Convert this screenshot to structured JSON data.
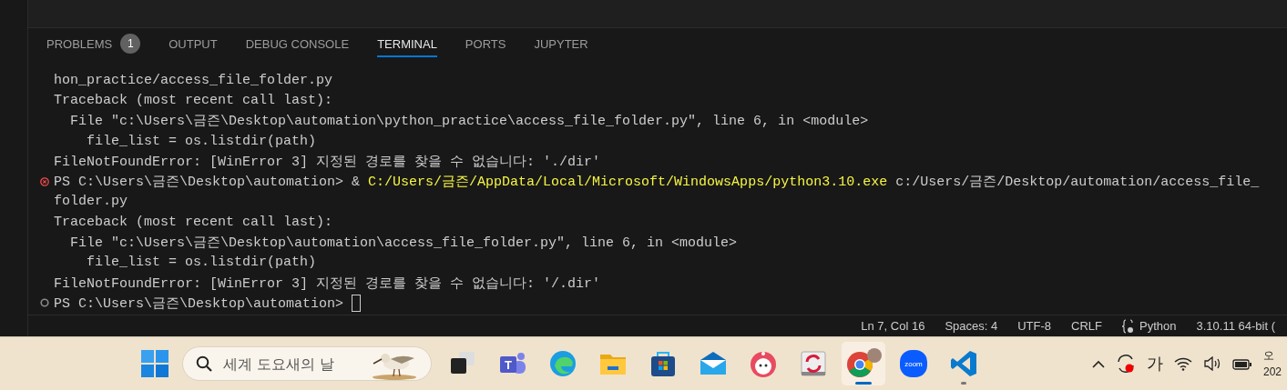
{
  "panel": {
    "tabs": [
      {
        "label": "PROBLEMS",
        "badge": "1",
        "selected": false
      },
      {
        "label": "OUTPUT",
        "selected": false
      },
      {
        "label": "DEBUG CONSOLE",
        "selected": false
      },
      {
        "label": "TERMINAL",
        "selected": true
      },
      {
        "label": "PORTS",
        "selected": false
      },
      {
        "label": "JUPYTER",
        "selected": false
      }
    ]
  },
  "terminal": {
    "lines": [
      {
        "prompt": false,
        "failed": false,
        "cursor": false,
        "segments": [
          {
            "kind": "plain",
            "text": "hon_practice/access_file_folder.py"
          }
        ]
      },
      {
        "prompt": false,
        "failed": false,
        "cursor": false,
        "segments": [
          {
            "kind": "plain",
            "text": "Traceback (most recent call last):"
          }
        ]
      },
      {
        "prompt": false,
        "failed": false,
        "cursor": false,
        "segments": [
          {
            "kind": "plain",
            "text": "  File \"c:\\Users\\금즌\\Desktop\\automation\\python_practice\\access_file_folder.py\", line 6, in <module>"
          }
        ]
      },
      {
        "prompt": false,
        "failed": false,
        "cursor": false,
        "segments": [
          {
            "kind": "plain",
            "text": "    file_list = os.listdir(path)"
          }
        ]
      },
      {
        "prompt": false,
        "failed": false,
        "cursor": false,
        "segments": [
          {
            "kind": "plain",
            "text": "FileNotFoundError: [WinError 3] 지정된 경로를 찾을 수 없습니다: './dir'"
          }
        ]
      },
      {
        "prompt": true,
        "failed": true,
        "cursor": false,
        "segments": [
          {
            "kind": "plain",
            "text": "PS C:\\Users\\금즌\\Desktop\\automation> & "
          },
          {
            "kind": "command",
            "text": "C:/Users/금즌/AppData/Local/Microsoft/WindowsApps/python3.10.exe"
          },
          {
            "kind": "plain",
            "text": " c:/Users/금즌/Desktop/automation/access_file_"
          }
        ]
      },
      {
        "prompt": false,
        "failed": false,
        "cursor": false,
        "segments": [
          {
            "kind": "plain",
            "text": "folder.py"
          }
        ]
      },
      {
        "prompt": false,
        "failed": false,
        "cursor": false,
        "segments": [
          {
            "kind": "plain",
            "text": "Traceback (most recent call last):"
          }
        ]
      },
      {
        "prompt": false,
        "failed": false,
        "cursor": false,
        "segments": [
          {
            "kind": "plain",
            "text": "  File \"c:\\Users\\금즌\\Desktop\\automation\\access_file_folder.py\", line 6, in <module>"
          }
        ]
      },
      {
        "prompt": false,
        "failed": false,
        "cursor": false,
        "segments": [
          {
            "kind": "plain",
            "text": "    file_list = os.listdir(path)"
          }
        ]
      },
      {
        "prompt": false,
        "failed": false,
        "cursor": false,
        "segments": [
          {
            "kind": "plain",
            "text": "FileNotFoundError: [WinError 3] 지정된 경로를 찾을 수 없습니다: '/.dir'"
          }
        ]
      },
      {
        "prompt": true,
        "failed": false,
        "cursor": true,
        "segments": [
          {
            "kind": "plain",
            "text": "PS C:\\Users\\금즌\\Desktop\\automation> "
          }
        ]
      }
    ]
  },
  "status_bar": {
    "items": [
      {
        "kind": "text",
        "text": "Ln 7, Col 16"
      },
      {
        "kind": "text",
        "text": "Spaces: 4"
      },
      {
        "kind": "text",
        "text": "UTF-8"
      },
      {
        "kind": "text",
        "text": "CRLF"
      },
      {
        "kind": "language",
        "text": "Python"
      },
      {
        "kind": "text",
        "text": "3.10.11 64-bit ("
      }
    ]
  },
  "taskbar": {
    "search": {
      "placeholder": "세계 도요새의 날"
    },
    "apps": [
      {
        "kind": "task-view",
        "selected": false,
        "running": false
      },
      {
        "kind": "teams",
        "label": "T",
        "selected": false,
        "running": false
      },
      {
        "kind": "edge",
        "selected": false,
        "running": false
      },
      {
        "kind": "files",
        "selected": false,
        "running": false
      },
      {
        "kind": "store",
        "selected": false,
        "running": false
      },
      {
        "kind": "mail",
        "selected": false,
        "running": false
      },
      {
        "kind": "bot",
        "selected": false,
        "running": false
      },
      {
        "kind": "sync-app",
        "selected": false,
        "running": false
      },
      {
        "kind": "chrome",
        "selected": true,
        "running": true
      },
      {
        "kind": "zoom",
        "label": "zoom",
        "selected": false,
        "running": false
      },
      {
        "kind": "vscode",
        "selected": false,
        "running": true
      }
    ],
    "tray": [
      {
        "kind": "caret"
      },
      {
        "kind": "sync"
      },
      {
        "kind": "ime",
        "label": "가"
      },
      {
        "kind": "wifi"
      },
      {
        "kind": "volume"
      },
      {
        "kind": "battery"
      }
    ],
    "clock": {
      "time": "오",
      "date": "202"
    }
  }
}
